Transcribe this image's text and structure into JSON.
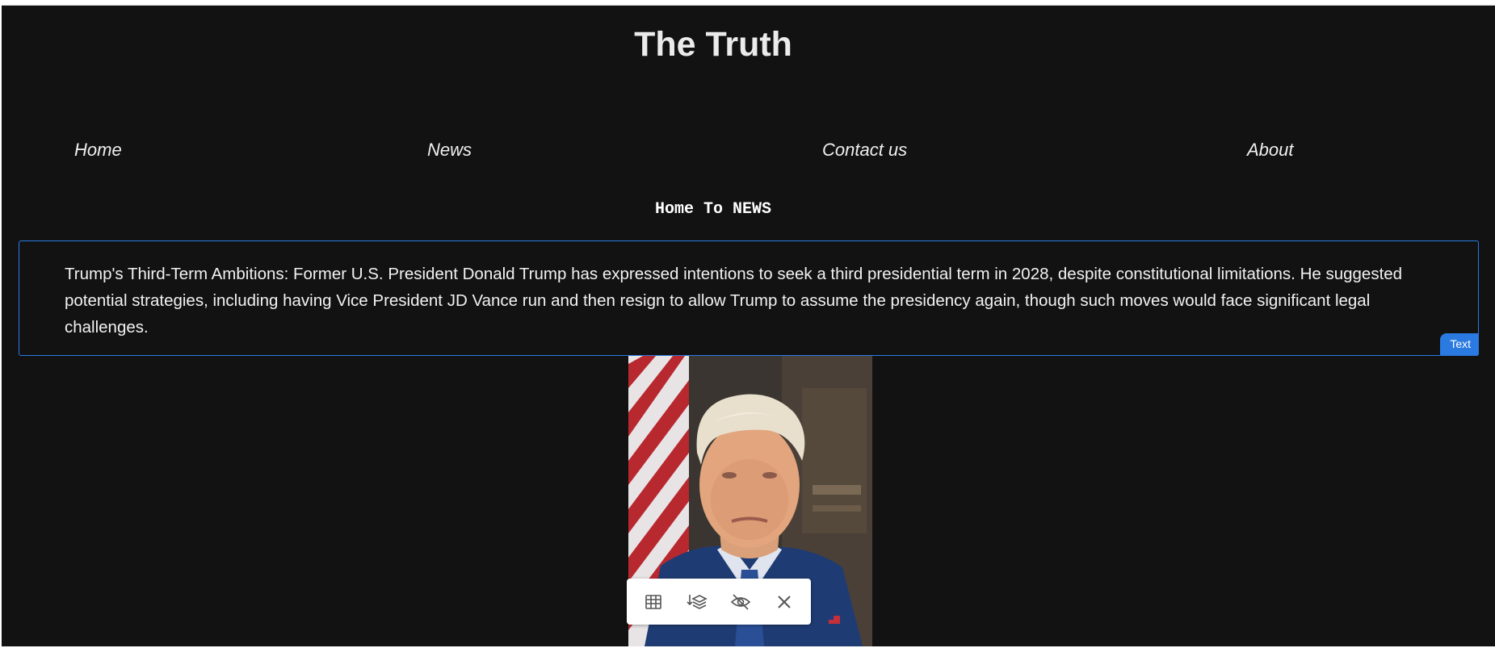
{
  "site": {
    "title": "The Truth"
  },
  "nav": {
    "items": [
      {
        "label": "Home"
      },
      {
        "label": "News"
      },
      {
        "label": "Contact us"
      },
      {
        "label": "About"
      }
    ]
  },
  "section": {
    "heading": "Home To NEWS"
  },
  "article": {
    "text": "Trump's Third-Term Ambitions: Former U.S. President Donald Trump has expressed intentions to seek a third presidential term in 2028, despite constitutional limitations. He suggested potential strategies, including having Vice President JD Vance run and then resign to allow Trump to assume the presidency again, though such moves would face significant legal challenges.",
    "badge": "Text"
  },
  "toolbar": {
    "icons": [
      "table-icon",
      "layers-sort-icon",
      "eye-off-icon",
      "close-icon"
    ]
  },
  "colors": {
    "background": "#121212",
    "accent": "#2a7ae2",
    "text": "#f2f2f2"
  }
}
